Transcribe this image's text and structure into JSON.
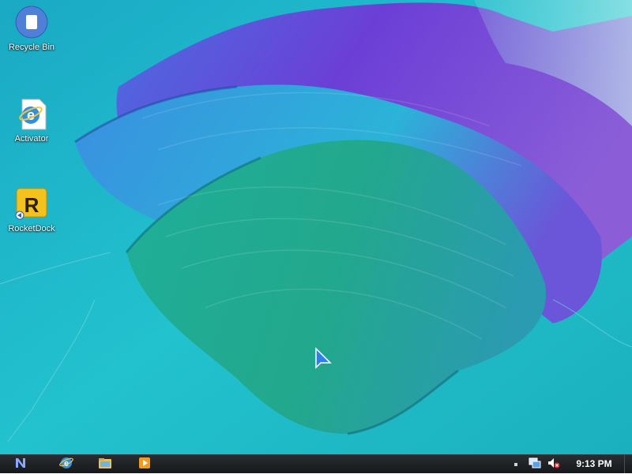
{
  "desktop": {
    "icons": [
      {
        "label": "Recycle Bin",
        "icon": "recycle-bin-icon"
      },
      {
        "label": "Activator",
        "icon": "internet-explorer-shortcut-icon"
      },
      {
        "label": "RocketDock",
        "icon": "rocketdock-icon"
      }
    ],
    "wallpaper": "abstract-paint-stroke-teal-purple"
  },
  "taskbar": {
    "start_icon": "start-n-logo-icon",
    "pinned": [
      {
        "icon": "internet-explorer-icon"
      },
      {
        "icon": "file-explorer-icon"
      },
      {
        "icon": "media-player-icon"
      }
    ],
    "tray": [
      {
        "icon": "show-hidden-icons-icon"
      },
      {
        "icon": "network-icon"
      },
      {
        "icon": "volume-muted-icon"
      }
    ],
    "clock": "9:13 PM"
  },
  "colors": {
    "accent": "#1fb7c7",
    "taskbar": "#1e2024",
    "purple": "#6a3fd3"
  }
}
